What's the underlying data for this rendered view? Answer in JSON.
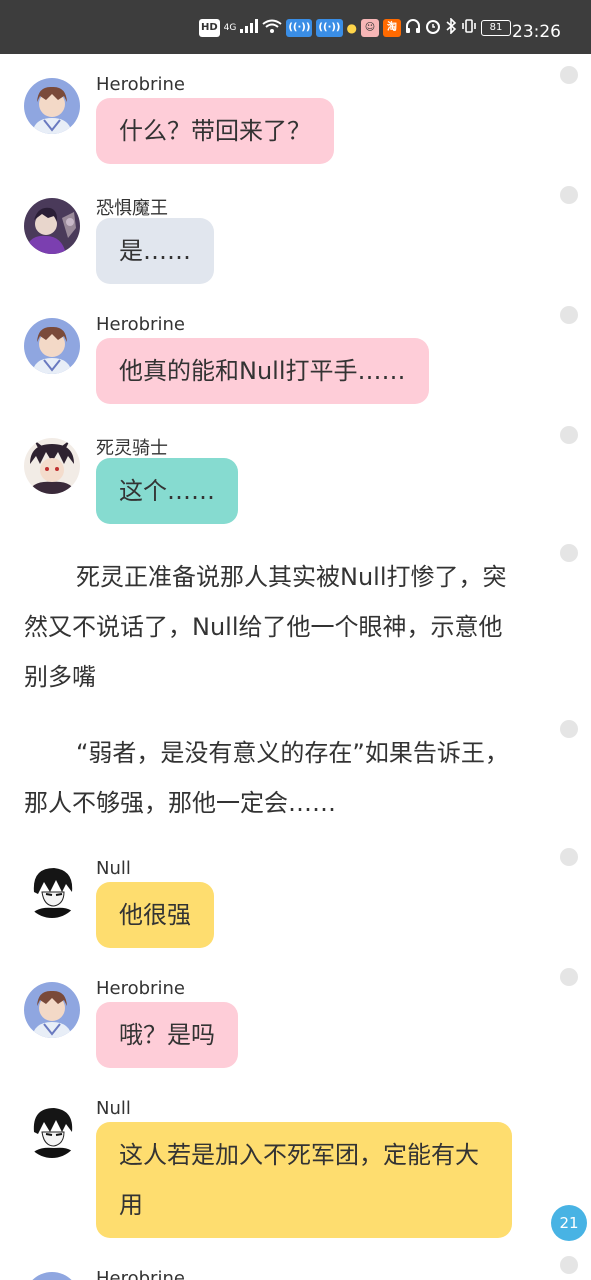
{
  "status_bar": {
    "hd": "HD",
    "network": "4G",
    "app_icon_1": "淘",
    "battery": "81",
    "time": "23:26"
  },
  "messages": [
    {
      "sender": "Herobrine",
      "text": "什么？带回来了？"
    },
    {
      "sender": "恐惧魔王",
      "text": "是……"
    },
    {
      "sender": "Herobrine",
      "text": "他真的能和Null打平手……"
    },
    {
      "sender": "死灵骑士",
      "text": "这个……"
    },
    {
      "sender": "Null",
      "text": "他很强"
    },
    {
      "sender": "Herobrine",
      "text": "哦？是吗"
    },
    {
      "sender": "Null",
      "text": "这人若是加入不死军团，定能有大用"
    },
    {
      "sender": "Herobrine",
      "text": ""
    }
  ],
  "narration": [
    "死灵正准备说那人其实被Null打惨了，突然又不说话了，Null给了他一个眼神，示意他别多嘴",
    "“弱者，是没有意义的存在”如果告诉王，那人不够强，那他一定会……"
  ],
  "unread_badge": "21",
  "colors": {
    "status_bar": "#3d3d3d",
    "bubble_herobrine": "#fecdd8",
    "bubble_fear_king": "#e1e6ee",
    "bubble_death_knight": "#86dbd0",
    "bubble_null": "#fedd6f",
    "badge": "#48b3e4"
  },
  "icons": [
    "signal-icon",
    "wifi-icon",
    "hotspot-icon",
    "bulb-icon",
    "taobao-icon",
    "headphones-icon",
    "alarm-icon",
    "bluetooth-icon",
    "vibrate-icon",
    "battery-icon"
  ]
}
